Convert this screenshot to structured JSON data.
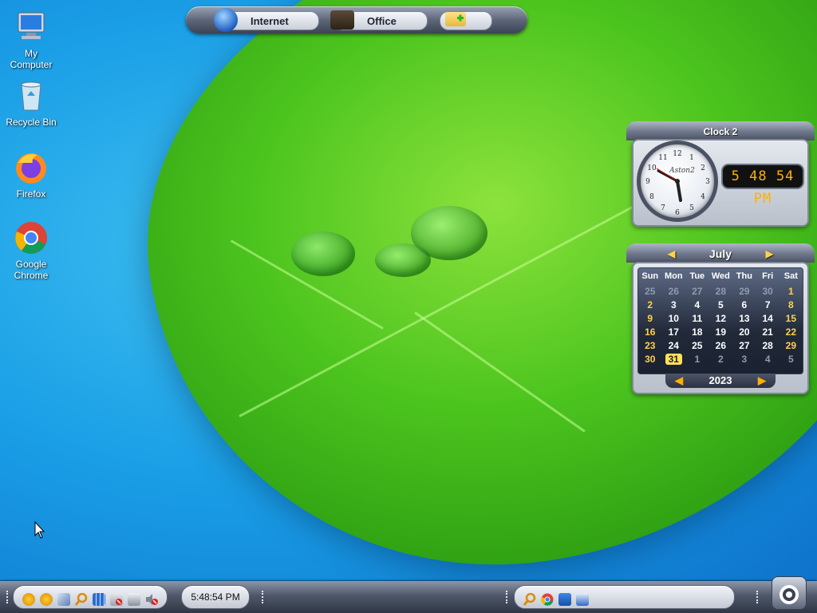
{
  "desktop": {
    "icons": [
      {
        "label": "My Computer",
        "icon": "computer-icon"
      },
      {
        "label": "Recycle Bin",
        "icon": "recycle-bin-icon"
      },
      {
        "label": "Firefox",
        "icon": "firefox-icon"
      },
      {
        "label": "Google Chrome",
        "icon": "chrome-icon"
      }
    ]
  },
  "toolbar": {
    "internet_label": "Internet",
    "office_label": "Office",
    "internet_icon": "globe-icon",
    "office_icon": "briefcase-icon",
    "add_icon": "folder-add-icon"
  },
  "clock": {
    "title": "Clock 2",
    "face_brand": "Aston2",
    "digital_time": "5 48 54 PM"
  },
  "calendar": {
    "month": "July",
    "year": "2023",
    "weekdays": [
      "Sun",
      "Mon",
      "Tue",
      "Wed",
      "Thu",
      "Fri",
      "Sat"
    ],
    "rows": [
      [
        "25",
        "26",
        "27",
        "28",
        "29",
        "30",
        "1"
      ],
      [
        "2",
        "3",
        "4",
        "5",
        "6",
        "7",
        "8"
      ],
      [
        "9",
        "10",
        "11",
        "12",
        "13",
        "14",
        "15"
      ],
      [
        "16",
        "17",
        "18",
        "19",
        "20",
        "21",
        "22"
      ],
      [
        "23",
        "24",
        "25",
        "26",
        "27",
        "28",
        "29"
      ],
      [
        "30",
        "31",
        "1",
        "2",
        "3",
        "4",
        "5"
      ]
    ],
    "today": "31"
  },
  "taskbar": {
    "time": "5:48:54 PM",
    "tray_icons": [
      "bitcoin-icon",
      "bitcoin-icon",
      "pen-icon",
      "search-icon",
      "grid-icon",
      "network-off-icon",
      "display-icon",
      "mute-icon"
    ],
    "quicklaunch_icons": [
      "search-icon",
      "chrome-icon",
      "desktop-icon",
      "window-icon"
    ]
  },
  "colors": {
    "accent_yellow": "#ffd24a",
    "digital_amber": "#ffb000"
  }
}
